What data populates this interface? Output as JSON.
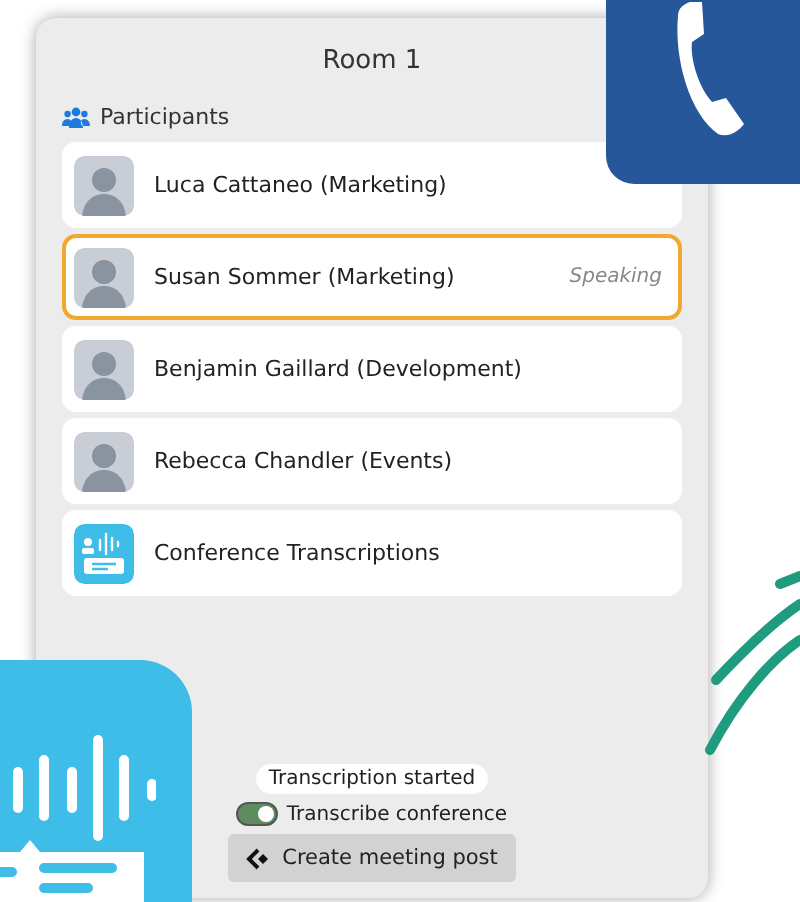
{
  "room": {
    "title": "Room 1"
  },
  "participants_label": "Participants",
  "participants": [
    {
      "kind": "person",
      "name": "Luca Cattaneo (Marketing)",
      "speaking": false
    },
    {
      "kind": "person",
      "name": "Susan Sommer (Marketing)",
      "speaking": true,
      "status": "Speaking"
    },
    {
      "kind": "person",
      "name": "Benjamin Gaillard (Development)",
      "speaking": false
    },
    {
      "kind": "person",
      "name": "Rebecca Chandler (Events)",
      "speaking": false
    },
    {
      "kind": "service",
      "name": "Conference Transcriptions",
      "speaking": false
    }
  ],
  "transcription": {
    "status": "Transcription started",
    "label": "Transcribe conference",
    "on": true
  },
  "button": {
    "label": "Create meeting post"
  }
}
